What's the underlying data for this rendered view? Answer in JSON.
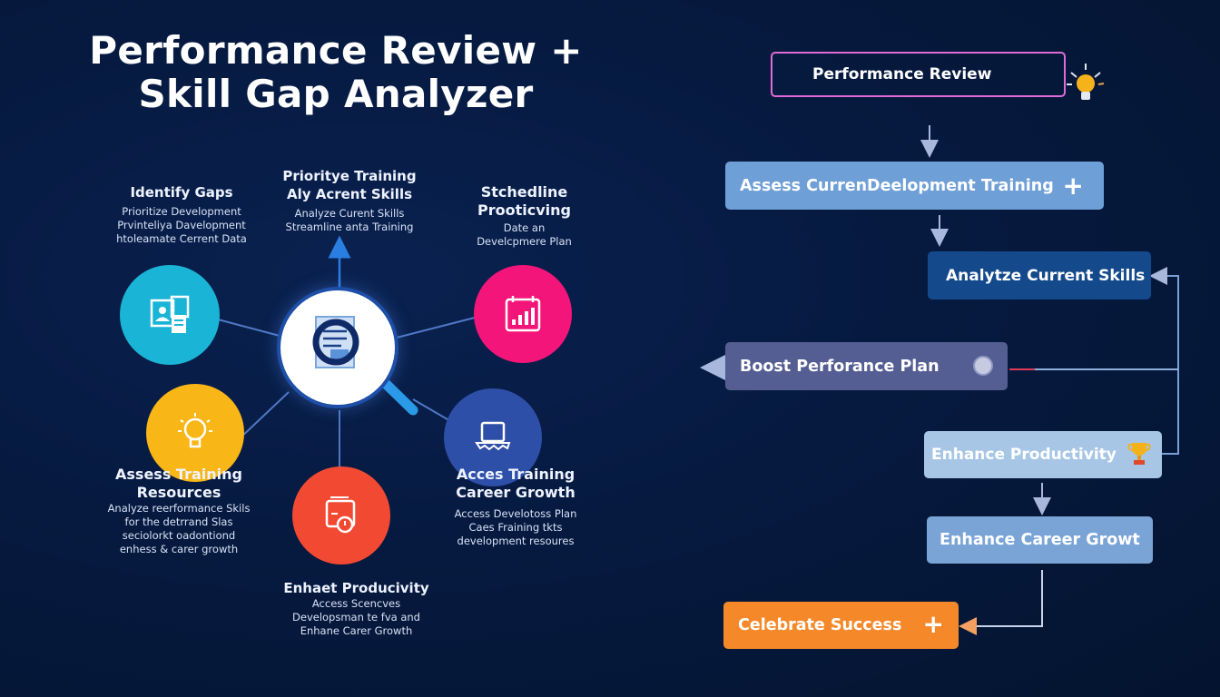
{
  "title": {
    "line1": "Performance Review +",
    "line2": "Skill Gap Analyzer"
  },
  "hub": {
    "center": {
      "icon": "magnifier-document-icon"
    },
    "nodes": [
      {
        "id": "identify",
        "icon": "profile-documents-icon",
        "color": "#1ab4d6",
        "heading": [
          "Identify Gaps"
        ],
        "subtext": [
          "Prioritize Development",
          "Prvinteliya Davelopment",
          "htoleamate Cerrent Data"
        ]
      },
      {
        "id": "prioritize",
        "icon": "arrow-up-icon",
        "color": "#2a7de1",
        "heading": [
          "Prioritye Training",
          "Aly Acrent Skills"
        ],
        "subtext": [
          "Analyze Curent Skills",
          "Streamline anta Training"
        ]
      },
      {
        "id": "schedule",
        "icon": "calendar-chart-icon",
        "color": "#f4157a",
        "heading": [
          "Stchedline",
          "Prooticving"
        ],
        "subtext": [
          "Date an",
          "Develcpmere Plan"
        ]
      },
      {
        "id": "assess",
        "icon": "lightbulb-icon",
        "color": "#f8b617",
        "heading": [
          "Assess Training",
          "Resources"
        ],
        "subtext": [
          "Analyze reerformance Skils",
          "for the detrrand Slas",
          "seciolorkt oadontiond",
          "enhess & carer growth"
        ]
      },
      {
        "id": "access",
        "icon": "laptop-icon",
        "color": "#2e4fa8",
        "heading": [
          "Acces Training",
          "Career Growth"
        ],
        "subtext": [
          "Access Develotoss Plan",
          "Caes Fraining tkts",
          "development resoures"
        ]
      },
      {
        "id": "enhance",
        "icon": "document-clock-icon",
        "color": "#f24a32",
        "heading": [
          "Enhaet Producivity"
        ],
        "subtext": [
          "Access Scencves",
          "Developsman te fva and",
          "Enhane Carer Growth"
        ]
      }
    ]
  },
  "flow": {
    "steps": [
      {
        "label": "Performance Review",
        "icon": "lightbulb-icon",
        "style": "outline",
        "border": "#e06ad6"
      },
      {
        "label": "Assess CurrenDeelopment Training",
        "icon": "plus-icon",
        "bg": "#6e9fd6"
      },
      {
        "label": "Analytze Current Skills",
        "icon": "",
        "bg": "#144a8c"
      },
      {
        "label": "Boost Perforance Plan",
        "icon": "person-badge-icon",
        "bg": "#545e92"
      },
      {
        "label": "Enhance Productivity",
        "icon": "trophy-icon",
        "bg": "#a7c6e6"
      },
      {
        "label": "Enhance Career Growt",
        "icon": "",
        "bg": "#7aa4d6"
      },
      {
        "label": "Celebrate Success",
        "icon": "plus-icon",
        "bg": "#f5892a"
      }
    ]
  },
  "colors": {
    "background": "#05173a",
    "connector": "#5a7cc0",
    "flow_arrow": "#a8b8dc"
  }
}
